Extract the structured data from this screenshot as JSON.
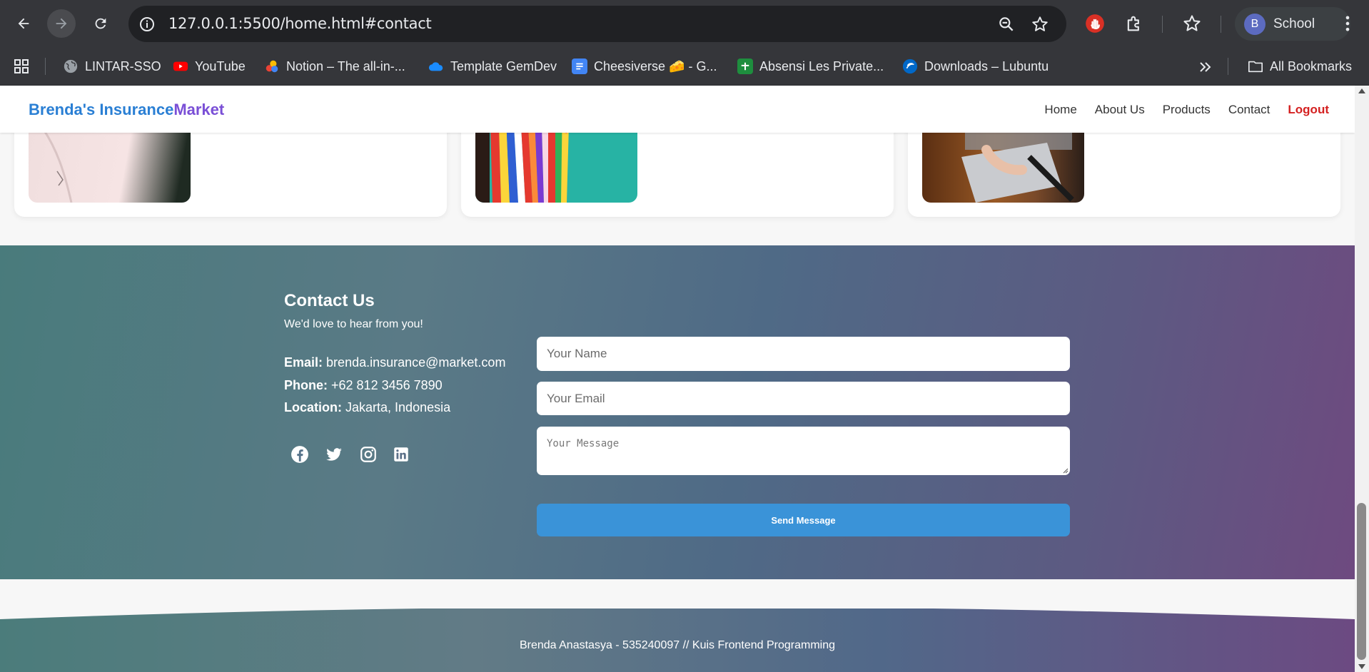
{
  "browser": {
    "url": "127.0.0.1:5500/home.html#contact",
    "profile_initial": "B",
    "profile_name": "School",
    "bookmarks": [
      {
        "label": "LINTAR-SSO",
        "icon": "globe-icon"
      },
      {
        "label": "YouTube",
        "icon": "youtube-icon"
      },
      {
        "label": "Notion – The all-in-...",
        "icon": "notion-icon"
      },
      {
        "label": "Template GemDev",
        "icon": "cloud-icon"
      },
      {
        "label": "Cheesiverse 🧀 - G...",
        "icon": "docs-icon"
      },
      {
        "label": "Absensi Les Private...",
        "icon": "sheets-icon"
      },
      {
        "label": "Downloads – Lubuntu",
        "icon": "lubuntu-icon"
      }
    ],
    "all_bookmarks": "All Bookmarks"
  },
  "site": {
    "brand_part1": "Brenda's Insurance",
    "brand_part2": "Market",
    "nav": [
      "Home",
      "About Us",
      "Products",
      "Contact",
      "Logout"
    ]
  },
  "contact": {
    "title": "Contact Us",
    "subtitle": "We'd love to hear from you!",
    "email_label": "Email:",
    "email": "brenda.insurance@market.com",
    "phone_label": "Phone:",
    "phone": "+62 812 3456 7890",
    "location_label": "Location:",
    "location": "Jakarta, Indonesia",
    "socials": [
      "facebook-icon",
      "twitter-icon",
      "instagram-icon",
      "linkedin-icon"
    ],
    "form": {
      "name_placeholder": "Your Name",
      "email_placeholder": "Your Email",
      "message_placeholder": "Your Message",
      "send_label": "Send Message"
    }
  },
  "footer": {
    "text": "Brenda Anastasya - 535240097 // Kuis Frontend Programming"
  },
  "colors": {
    "brand_blue": "#2a7fd4",
    "brand_purple": "#7a4fd6",
    "logout_red": "#d42020",
    "button_blue": "#3a93d8"
  }
}
